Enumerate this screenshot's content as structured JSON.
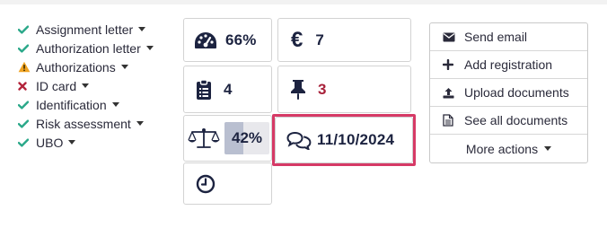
{
  "checklist": [
    {
      "label": "Assignment letter",
      "status": "ok",
      "status_icon": "check-icon"
    },
    {
      "label": "Authorization letter",
      "status": "ok",
      "status_icon": "check-icon"
    },
    {
      "label": "Authorizations",
      "status": "warning",
      "status_icon": "warning-icon"
    },
    {
      "label": "ID card",
      "status": "missing",
      "status_icon": "x-icon"
    },
    {
      "label": "Identification",
      "status": "ok",
      "status_icon": "check-icon"
    },
    {
      "label": "Risk assessment",
      "status": "ok",
      "status_icon": "check-icon"
    },
    {
      "label": "UBO",
      "status": "ok",
      "status_icon": "check-icon"
    }
  ],
  "tiles": {
    "score": {
      "icon": "gauge-icon",
      "value": "66%"
    },
    "price": {
      "icon": "euro-icon",
      "value": "7"
    },
    "tasks": {
      "icon": "clipboard-icon",
      "value": "4"
    },
    "pins": {
      "icon": "pin-icon",
      "value": "3"
    },
    "balance": {
      "icon": "scale-icon",
      "value": "42%",
      "progress_fraction": 0.42
    },
    "comments": {
      "icon": "comments-icon",
      "value": "11/10/2024"
    },
    "time": {
      "icon": "clock-icon",
      "value": ""
    }
  },
  "actions": [
    {
      "label": "Send email",
      "icon": "envelope-icon"
    },
    {
      "label": "Add registration",
      "icon": "plus-icon"
    },
    {
      "label": "Upload documents",
      "icon": "upload-icon"
    },
    {
      "label": "See all documents",
      "icon": "document-icon"
    },
    {
      "label": "More actions",
      "icon": "caret-down-icon"
    }
  ],
  "colors": {
    "ok": "#2aa889",
    "warning": "#f0a321",
    "missing": "#b3243b",
    "highlight": "#d63a66",
    "pin_value": "#a8213a",
    "value_text": "#1c2340"
  }
}
